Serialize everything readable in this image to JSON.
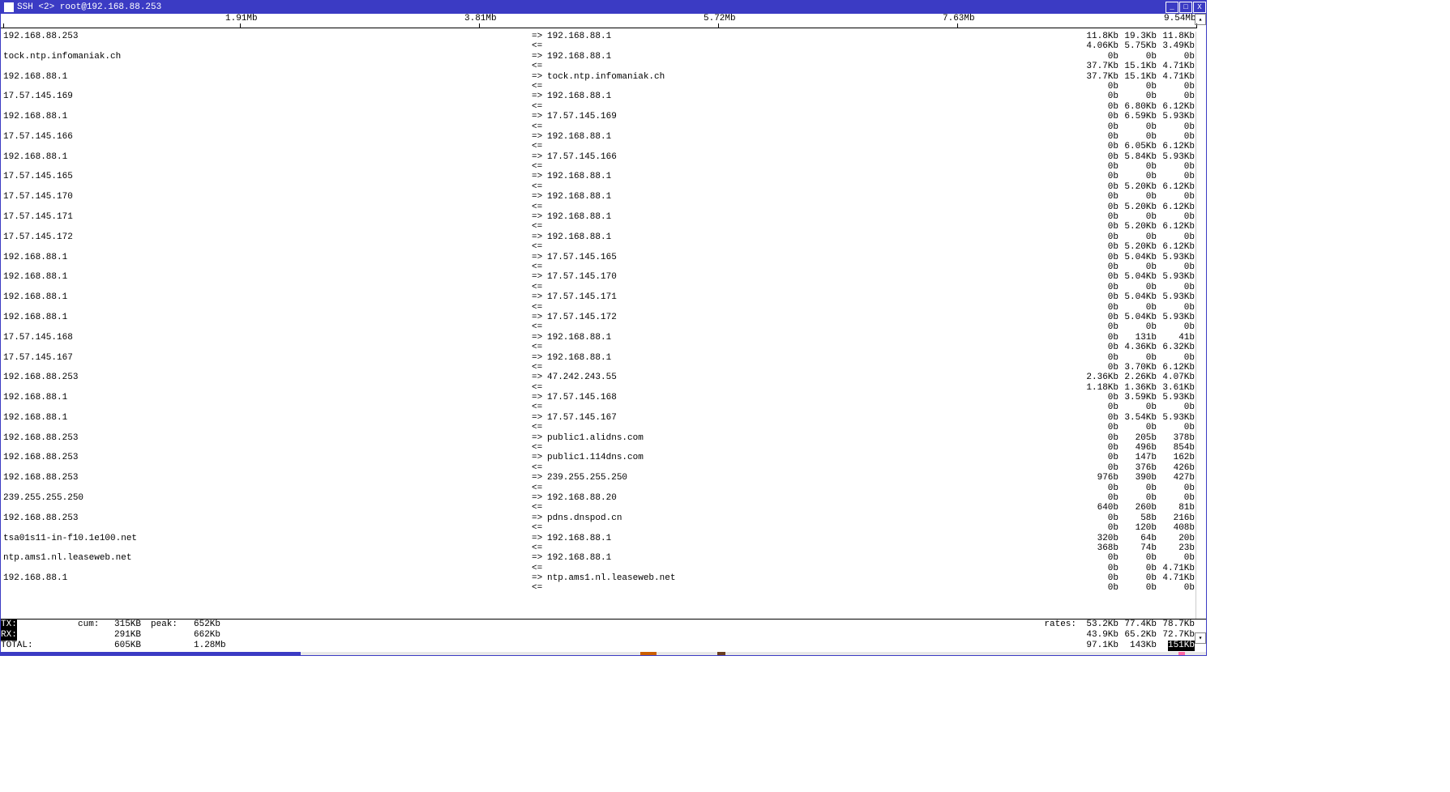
{
  "window": {
    "title": "SSH <2> root@192.168.88.253"
  },
  "window_buttons": {
    "min": "_",
    "max": "□",
    "close": "X"
  },
  "scale": {
    "labels": [
      "1.91Mb",
      "3.81Mb",
      "5.72Mb",
      "7.63Mb",
      "9.54Mb"
    ],
    "positions_pct": [
      20,
      40,
      60,
      80,
      100
    ]
  },
  "rows": [
    {
      "src": "192.168.88.253",
      "arrow": "=>",
      "dst": "192.168.88.1",
      "c1": "11.8Kb",
      "c2": "19.3Kb",
      "c3": "11.8Kb"
    },
    {
      "src": "",
      "arrow": "<=",
      "dst": "",
      "c1": "4.06Kb",
      "c2": "5.75Kb",
      "c3": "3.49Kb"
    },
    {
      "src": "tock.ntp.infomaniak.ch",
      "arrow": "=>",
      "dst": "192.168.88.1",
      "c1": "0b",
      "c2": "0b",
      "c3": "0b"
    },
    {
      "src": "",
      "arrow": "<=",
      "dst": "",
      "c1": "37.7Kb",
      "c2": "15.1Kb",
      "c3": "4.71Kb"
    },
    {
      "src": "192.168.88.1",
      "arrow": "=>",
      "dst": "tock.ntp.infomaniak.ch",
      "c1": "37.7Kb",
      "c2": "15.1Kb",
      "c3": "4.71Kb"
    },
    {
      "src": "",
      "arrow": "<=",
      "dst": "",
      "c1": "0b",
      "c2": "0b",
      "c3": "0b"
    },
    {
      "src": "17.57.145.169",
      "arrow": "=>",
      "dst": "192.168.88.1",
      "c1": "0b",
      "c2": "0b",
      "c3": "0b"
    },
    {
      "src": "",
      "arrow": "<=",
      "dst": "",
      "c1": "0b",
      "c2": "6.80Kb",
      "c3": "6.12Kb"
    },
    {
      "src": "192.168.88.1",
      "arrow": "=>",
      "dst": "17.57.145.169",
      "c1": "0b",
      "c2": "6.59Kb",
      "c3": "5.93Kb"
    },
    {
      "src": "",
      "arrow": "<=",
      "dst": "",
      "c1": "0b",
      "c2": "0b",
      "c3": "0b"
    },
    {
      "src": "17.57.145.166",
      "arrow": "=>",
      "dst": "192.168.88.1",
      "c1": "0b",
      "c2": "0b",
      "c3": "0b"
    },
    {
      "src": "",
      "arrow": "<=",
      "dst": "",
      "c1": "0b",
      "c2": "6.05Kb",
      "c3": "6.12Kb"
    },
    {
      "src": "192.168.88.1",
      "arrow": "=>",
      "dst": "17.57.145.166",
      "c1": "0b",
      "c2": "5.84Kb",
      "c3": "5.93Kb"
    },
    {
      "src": "",
      "arrow": "<=",
      "dst": "",
      "c1": "0b",
      "c2": "0b",
      "c3": "0b"
    },
    {
      "src": "17.57.145.165",
      "arrow": "=>",
      "dst": "192.168.88.1",
      "c1": "0b",
      "c2": "0b",
      "c3": "0b"
    },
    {
      "src": "",
      "arrow": "<=",
      "dst": "",
      "c1": "0b",
      "c2": "5.20Kb",
      "c3": "6.12Kb"
    },
    {
      "src": "17.57.145.170",
      "arrow": "=>",
      "dst": "192.168.88.1",
      "c1": "0b",
      "c2": "0b",
      "c3": "0b"
    },
    {
      "src": "",
      "arrow": "<=",
      "dst": "",
      "c1": "0b",
      "c2": "5.20Kb",
      "c3": "6.12Kb"
    },
    {
      "src": "17.57.145.171",
      "arrow": "=>",
      "dst": "192.168.88.1",
      "c1": "0b",
      "c2": "0b",
      "c3": "0b"
    },
    {
      "src": "",
      "arrow": "<=",
      "dst": "",
      "c1": "0b",
      "c2": "5.20Kb",
      "c3": "6.12Kb"
    },
    {
      "src": "17.57.145.172",
      "arrow": "=>",
      "dst": "192.168.88.1",
      "c1": "0b",
      "c2": "0b",
      "c3": "0b"
    },
    {
      "src": "",
      "arrow": "<=",
      "dst": "",
      "c1": "0b",
      "c2": "5.20Kb",
      "c3": "6.12Kb"
    },
    {
      "src": "192.168.88.1",
      "arrow": "=>",
      "dst": "17.57.145.165",
      "c1": "0b",
      "c2": "5.04Kb",
      "c3": "5.93Kb"
    },
    {
      "src": "",
      "arrow": "<=",
      "dst": "",
      "c1": "0b",
      "c2": "0b",
      "c3": "0b"
    },
    {
      "src": "192.168.88.1",
      "arrow": "=>",
      "dst": "17.57.145.170",
      "c1": "0b",
      "c2": "5.04Kb",
      "c3": "5.93Kb"
    },
    {
      "src": "",
      "arrow": "<=",
      "dst": "",
      "c1": "0b",
      "c2": "0b",
      "c3": "0b"
    },
    {
      "src": "192.168.88.1",
      "arrow": "=>",
      "dst": "17.57.145.171",
      "c1": "0b",
      "c2": "5.04Kb",
      "c3": "5.93Kb"
    },
    {
      "src": "",
      "arrow": "<=",
      "dst": "",
      "c1": "0b",
      "c2": "0b",
      "c3": "0b"
    },
    {
      "src": "192.168.88.1",
      "arrow": "=>",
      "dst": "17.57.145.172",
      "c1": "0b",
      "c2": "5.04Kb",
      "c3": "5.93Kb"
    },
    {
      "src": "",
      "arrow": "<=",
      "dst": "",
      "c1": "0b",
      "c2": "0b",
      "c3": "0b"
    },
    {
      "src": "17.57.145.168",
      "arrow": "=>",
      "dst": "192.168.88.1",
      "c1": "0b",
      "c2": "131b",
      "c3": "41b"
    },
    {
      "src": "",
      "arrow": "<=",
      "dst": "",
      "c1": "0b",
      "c2": "4.36Kb",
      "c3": "6.32Kb"
    },
    {
      "src": "17.57.145.167",
      "arrow": "=>",
      "dst": "192.168.88.1",
      "c1": "0b",
      "c2": "0b",
      "c3": "0b"
    },
    {
      "src": "",
      "arrow": "<=",
      "dst": "",
      "c1": "0b",
      "c2": "3.70Kb",
      "c3": "6.12Kb"
    },
    {
      "src": "192.168.88.253",
      "arrow": "=>",
      "dst": "47.242.243.55",
      "c1": "2.36Kb",
      "c2": "2.26Kb",
      "c3": "4.07Kb"
    },
    {
      "src": "",
      "arrow": "<=",
      "dst": "",
      "c1": "1.18Kb",
      "c2": "1.36Kb",
      "c3": "3.61Kb"
    },
    {
      "src": "192.168.88.1",
      "arrow": "=>",
      "dst": "17.57.145.168",
      "c1": "0b",
      "c2": "3.59Kb",
      "c3": "5.93Kb"
    },
    {
      "src": "",
      "arrow": "<=",
      "dst": "",
      "c1": "0b",
      "c2": "0b",
      "c3": "0b"
    },
    {
      "src": "192.168.88.1",
      "arrow": "=>",
      "dst": "17.57.145.167",
      "c1": "0b",
      "c2": "3.54Kb",
      "c3": "5.93Kb"
    },
    {
      "src": "",
      "arrow": "<=",
      "dst": "",
      "c1": "0b",
      "c2": "0b",
      "c3": "0b"
    },
    {
      "src": "192.168.88.253",
      "arrow": "=>",
      "dst": "public1.alidns.com",
      "c1": "0b",
      "c2": "205b",
      "c3": "378b"
    },
    {
      "src": "",
      "arrow": "<=",
      "dst": "",
      "c1": "0b",
      "c2": "496b",
      "c3": "854b"
    },
    {
      "src": "192.168.88.253",
      "arrow": "=>",
      "dst": "public1.114dns.com",
      "c1": "0b",
      "c2": "147b",
      "c3": "162b"
    },
    {
      "src": "",
      "arrow": "<=",
      "dst": "",
      "c1": "0b",
      "c2": "376b",
      "c3": "426b"
    },
    {
      "src": "192.168.88.253",
      "arrow": "=>",
      "dst": "239.255.255.250",
      "c1": "976b",
      "c2": "390b",
      "c3": "427b"
    },
    {
      "src": "",
      "arrow": "<=",
      "dst": "",
      "c1": "0b",
      "c2": "0b",
      "c3": "0b"
    },
    {
      "src": "239.255.255.250",
      "arrow": "=>",
      "dst": "192.168.88.20",
      "c1": "0b",
      "c2": "0b",
      "c3": "0b"
    },
    {
      "src": "",
      "arrow": "<=",
      "dst": "",
      "c1": "640b",
      "c2": "260b",
      "c3": "81b"
    },
    {
      "src": "192.168.88.253",
      "arrow": "=>",
      "dst": "pdns.dnspod.cn",
      "c1": "0b",
      "c2": "58b",
      "c3": "216b"
    },
    {
      "src": "",
      "arrow": "<=",
      "dst": "",
      "c1": "0b",
      "c2": "120b",
      "c3": "408b"
    },
    {
      "src": "tsa01s11-in-f10.1e100.net",
      "arrow": "=>",
      "dst": "192.168.88.1",
      "c1": "320b",
      "c2": "64b",
      "c3": "20b"
    },
    {
      "src": "",
      "arrow": "<=",
      "dst": "",
      "c1": "368b",
      "c2": "74b",
      "c3": "23b"
    },
    {
      "src": "ntp.ams1.nl.leaseweb.net",
      "arrow": "=>",
      "dst": "192.168.88.1",
      "c1": "0b",
      "c2": "0b",
      "c3": "0b"
    },
    {
      "src": "",
      "arrow": "<=",
      "dst": "",
      "c1": "0b",
      "c2": "0b",
      "c3": "4.71Kb"
    },
    {
      "src": "192.168.88.1",
      "arrow": "=>",
      "dst": "ntp.ams1.nl.leaseweb.net",
      "c1": "0b",
      "c2": "0b",
      "c3": "4.71Kb"
    },
    {
      "src": "",
      "arrow": "<=",
      "dst": "",
      "c1": "0b",
      "c2": "0b",
      "c3": "0b"
    }
  ],
  "footer": {
    "labels": {
      "tx": "TX:",
      "rx": "RX:",
      "total": "TOTAL:",
      "cum": "cum:",
      "peak": "peak:",
      "rates": "rates:"
    },
    "tx": {
      "cum": "315KB",
      "peak": "652Kb",
      "r1": "53.2Kb",
      "r2": "77.4Kb",
      "r3": "78.7Kb"
    },
    "rx": {
      "cum": "291KB",
      "peak": "662Kb",
      "r1": "43.9Kb",
      "r2": "65.2Kb",
      "r3": "72.7Kb"
    },
    "total": {
      "cum": "605KB",
      "peak": "1.28Mb",
      "r1": "97.1Kb",
      "r2": "143Kb",
      "r3": "151Kb"
    }
  },
  "taskbar_colors": [
    "#3b3bc4",
    "#e8e8e8",
    "#cc5f00",
    "#e8e8e8",
    "#6a3e1f",
    "#e8e8e8",
    "#ff66a3",
    "#e8e8e8"
  ],
  "taskbar_widths": [
    370,
    420,
    20,
    75,
    10,
    560,
    8,
    26
  ]
}
